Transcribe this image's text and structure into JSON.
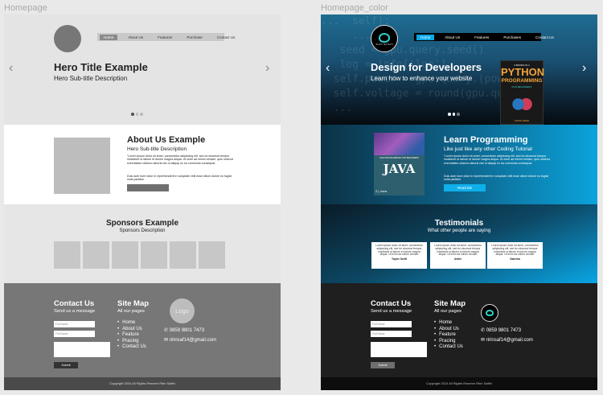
{
  "labels": {
    "left": "Homepage",
    "right": "Homepage_color"
  },
  "nav": [
    "Home",
    "About Us",
    "Features",
    "Purchase",
    "Contact Us"
  ],
  "nav_color": [
    "Home",
    "About Us",
    "Features",
    "Purchases",
    "Contact Us"
  ],
  "grey": {
    "hero_title": "Hero Title Example",
    "hero_sub": "Hero Sub-title Description",
    "about_title": "About Us Example",
    "about_sub": "Hero Sub-title Description",
    "spons_title": "Sponsors Example",
    "spons_sub": "Sponsors Description",
    "footer_logo": "Logo"
  },
  "color": {
    "logo_text": "BLACK TEA TECH",
    "hero_title": "Design for Developers",
    "hero_sub": "Learn how to enhance your website",
    "book": {
      "top": "3 BOOKS IN 1",
      "title1": "PYTHON",
      "title2": "PROGRAMMING",
      "sub": "FOR BEGINNERS",
      "author": "MARK REED"
    },
    "java": {
      "top": "JAVA PROGRAMMING FOR BEGINNERS",
      "title": "JAVA",
      "edition": "2 | Java"
    },
    "about_title": "Learn Programming",
    "about_sub": "Like just like any other Coding Tutorial",
    "read_more": "Read Me",
    "spons_title": "Testimonials",
    "spons_sub": "What other people are saying"
  },
  "about_body": "\"Lorem ipsum dolor sit amet, consectetur adipiscing elit, sed do eiusmod tempor incididunt ut labore et dolore magna aliqua. Ut enim ad minim veniam, quis nostrud exercitation ullamco laboris nisi ut aliquip ex ea commodo consequat.",
  "about_body2": "Duis aute irure dolor in reprehenderit in voluptate velit esse cillum dolore eu fugiat nulla pariatur.",
  "testimonials": [
    {
      "quote": "Lorem ipsum dolor sit amet, consectetur adipiscing elit, sed do eiusmod tempor incididunt ut labore et dolore magna aliqua. Ut enim ad minim veniam",
      "name": "Taylor Swift"
    },
    {
      "quote": "Lorem ipsum dolor sit amet, consectetur adipiscing elit, sed do eiusmod tempor incididunt ut labore et dolore magna aliqua. Ut enim ad minim veniam",
      "name": "Adele"
    },
    {
      "quote": "Lorem ipsum dolor sit amet, consectetur adipiscing elit, sed do eiusmod tempor incididunt ut labore et dolore magna aliqua. Ut enim ad minim veniam",
      "name": "Sabrina"
    }
  ],
  "footer": {
    "contact_title": "Contact Us",
    "contact_sub": "Send us a message",
    "full_name": "Full Name",
    "submit": "Submit",
    "sitemap_title": "Site Map",
    "sitemap_sub": "All our pages",
    "sitemap": [
      "Home",
      "About Us",
      "Feature",
      "Pracing",
      "Contact Us"
    ],
    "phone": "0859 9801 7473",
    "email": "ririnsaf14@gmail.com",
    "copyright": "Copyright 2024 All Rights Reserve Ririn Safitri"
  },
  "code_lines": [
    "...  self):",
    "     ...",
    "   seed = gpu.query.seed()",
    "   log = info['log']",
    "  self.power = gpu.query.(power)",
    "  self.voltage = round(gpu.query",
    "  ...",
    ""
  ]
}
